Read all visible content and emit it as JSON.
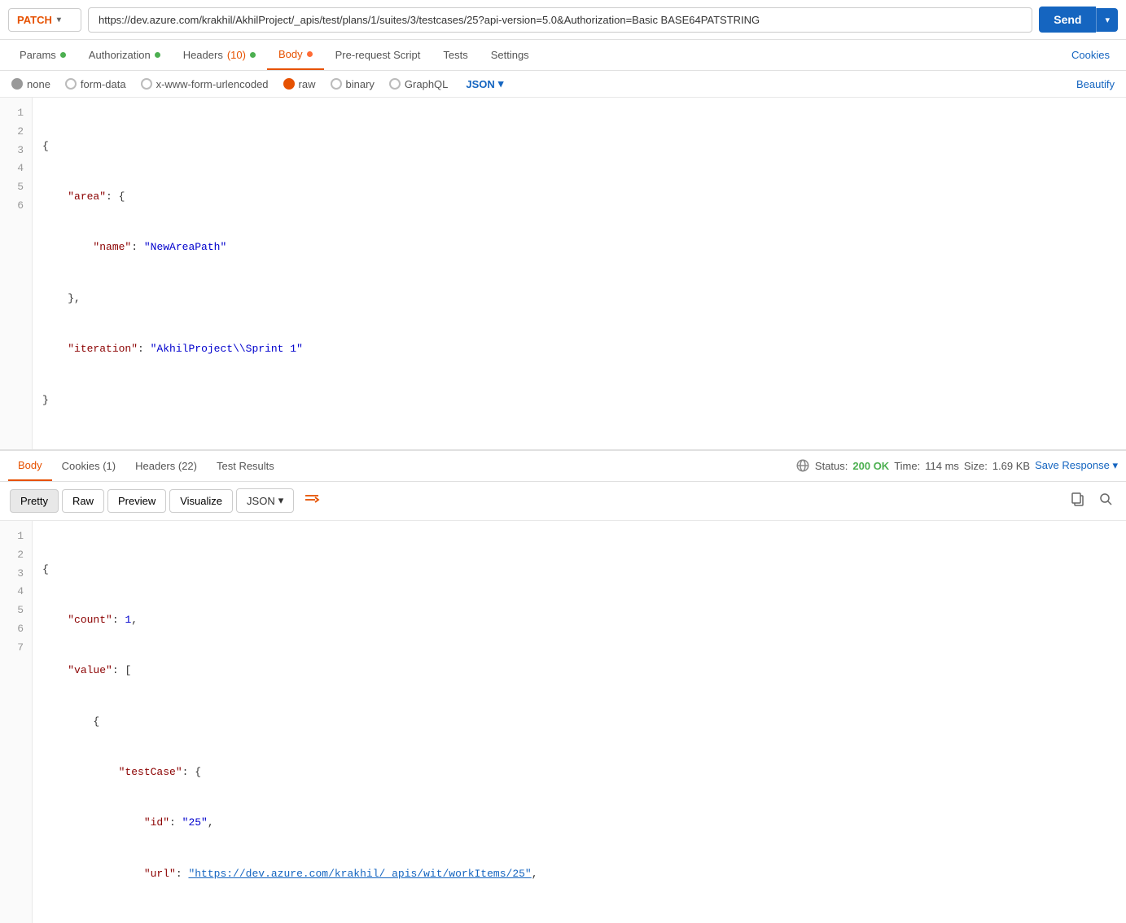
{
  "topbar": {
    "method": "PATCH",
    "url": "https://dev.azure.com/krakhil/AkhilProject/_apis/test/plans/1/suites/3/testcases/25?api-version=5.0&Authorization=Basic BASE64PATSTRING",
    "send_label": "Send",
    "send_arrow": "▾"
  },
  "request_tabs": [
    {
      "id": "params",
      "label": "Params",
      "dot": "green",
      "active": false
    },
    {
      "id": "authorization",
      "label": "Authorization",
      "dot": "green",
      "active": false
    },
    {
      "id": "headers",
      "label": "Headers",
      "count": "(10)",
      "dot": "green",
      "active": false
    },
    {
      "id": "body",
      "label": "Body",
      "dot": "orange",
      "active": true
    },
    {
      "id": "pre-request-script",
      "label": "Pre-request Script",
      "dot": null,
      "active": false
    },
    {
      "id": "tests",
      "label": "Tests",
      "dot": null,
      "active": false
    },
    {
      "id": "settings",
      "label": "Settings",
      "dot": null,
      "active": false
    }
  ],
  "cookies_link": "Cookies",
  "body_types": [
    {
      "id": "none",
      "label": "none",
      "selected": false
    },
    {
      "id": "form-data",
      "label": "form-data",
      "selected": false
    },
    {
      "id": "x-www-form-urlencoded",
      "label": "x-www-form-urlencoded",
      "selected": false
    },
    {
      "id": "raw",
      "label": "raw",
      "selected": true
    },
    {
      "id": "binary",
      "label": "binary",
      "selected": false
    },
    {
      "id": "GraphQL",
      "label": "GraphQL",
      "selected": false
    }
  ],
  "json_dropdown": "JSON",
  "beautify": "Beautify",
  "request_body_lines": [
    {
      "num": 1,
      "text": "{"
    },
    {
      "num": 2,
      "text": "    \"area\": {"
    },
    {
      "num": 3,
      "text": "        \"name\": \"NewAreaPath\""
    },
    {
      "num": 4,
      "text": "    },"
    },
    {
      "num": 5,
      "text": "    \"iteration\": \"AkhilProject\\\\Sprint 1\""
    },
    {
      "num": 6,
      "text": "}"
    }
  ],
  "response_tabs": [
    {
      "id": "body",
      "label": "Body",
      "active": true
    },
    {
      "id": "cookies",
      "label": "Cookies (1)",
      "active": false
    },
    {
      "id": "headers",
      "label": "Headers (22)",
      "active": false
    },
    {
      "id": "test-results",
      "label": "Test Results",
      "active": false
    }
  ],
  "status": {
    "label": "Status:",
    "value": "200 OK",
    "time_label": "Time:",
    "time_value": "114 ms",
    "size_label": "Size:",
    "size_value": "1.69 KB"
  },
  "save_response": "Save Response",
  "response_formats": [
    "Pretty",
    "Raw",
    "Preview",
    "Visualize"
  ],
  "active_format": "Pretty",
  "response_json_dropdown": "JSON",
  "response_body_lines": [
    {
      "num": 1,
      "text": "{"
    },
    {
      "num": 2,
      "text": "    \"count\": 1,"
    },
    {
      "num": 3,
      "text": "    \"value\": ["
    },
    {
      "num": 4,
      "text": "        {"
    },
    {
      "num": 5,
      "text": "            \"testCase\": {"
    },
    {
      "num": 6,
      "text": "                \"id\": \"25\","
    },
    {
      "num": 7,
      "text": "                \"url\": \"https://dev.azure.com/krakhil/_apis/wit/workItems/25\","
    }
  ]
}
